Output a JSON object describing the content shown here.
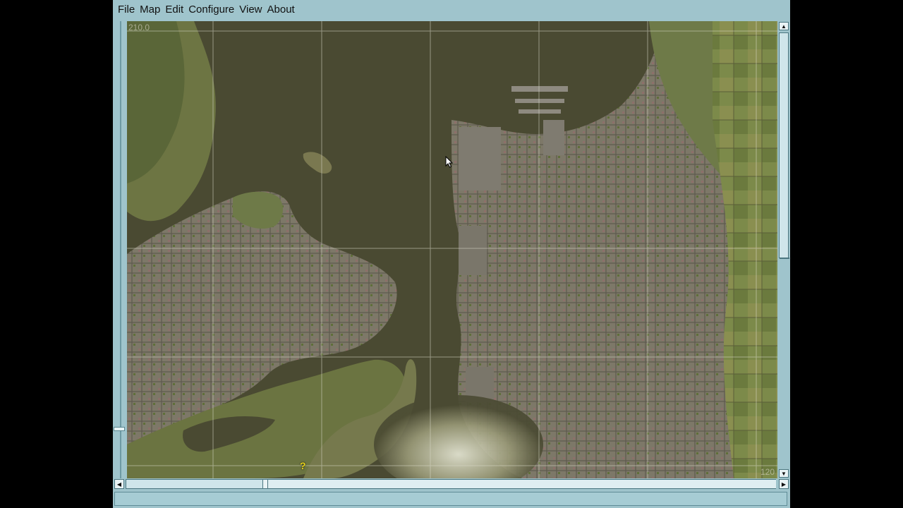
{
  "menubar": {
    "items": [
      {
        "label": "File"
      },
      {
        "label": "Map"
      },
      {
        "label": "Edit"
      },
      {
        "label": "Configure"
      },
      {
        "label": "View"
      },
      {
        "label": "About"
      }
    ]
  },
  "map": {
    "coord_top_left": "210.0",
    "coord_bottom_right": "120",
    "marker_glyph": "?",
    "marker_color": "#e6d21a",
    "water_color": "#4a4a32",
    "land_color": "#6f7445",
    "urban_color": "#7a7466"
  },
  "scroll": {
    "up_arrow": "▲",
    "down_arrow": "▼",
    "left_arrow": "◀",
    "right_arrow": "▶"
  },
  "status": {
    "text": ""
  },
  "colors": {
    "chrome": "#9fc4cc",
    "scroll_border": "#4b7680"
  }
}
